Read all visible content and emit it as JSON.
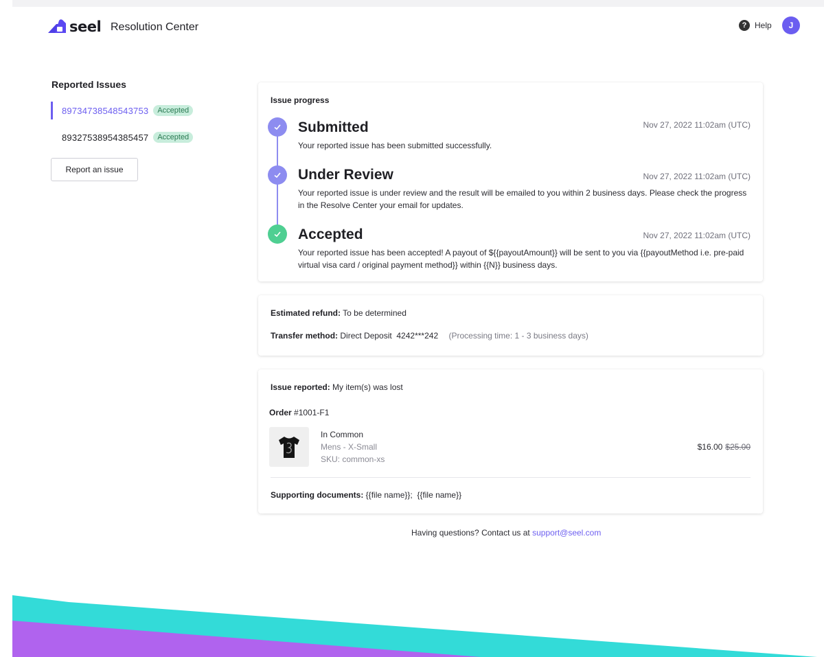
{
  "header": {
    "logo_word": "seel",
    "app_title": "Resolution Center",
    "help_label": "Help",
    "avatar_initial": "J"
  },
  "sidebar": {
    "title": "Reported Issues",
    "issues": [
      {
        "id": "89734738548543753",
        "status": "Accepted",
        "active": true
      },
      {
        "id": "89327538954385457",
        "status": "Accepted",
        "active": false
      }
    ],
    "report_button": "Report an issue"
  },
  "progress": {
    "heading": "Issue progress",
    "steps": [
      {
        "title": "Submitted",
        "time": "Nov 27, 2022  11:02am (UTC)",
        "desc": "Your reported issue has been submitted successfully.",
        "color": "#8d8cf0"
      },
      {
        "title": "Under Review",
        "time": "Nov 27, 2022  11:02am (UTC)",
        "desc": "Your reported issue is under review and the result will be emailed to you within 2 business days. Please check the progress in the Resolve Center your email for updates.",
        "color": "#8d8cf0"
      },
      {
        "title": "Accepted",
        "time": "Nov 27, 2022  11:02am (UTC)",
        "desc": "Your reported issue has been accepted! A payout of ${{payoutAmount}} will be sent to you via {{payoutMethod i.e. pre-paid virtual visa card / original payment method}} within {{N}} business days.",
        "color": "#4fcf92"
      }
    ]
  },
  "refund": {
    "estimated_label": "Estimated refund:",
    "estimated_value": "To be determined",
    "transfer_label": "Transfer method:",
    "transfer_value": "Direct Deposit  4242***242",
    "processing_note": "(Processing time: 1 - 3 business days)"
  },
  "reported": {
    "issue_label": "Issue reported:",
    "issue_value": "My item(s) was lost",
    "order_label": "Order",
    "order_number": "#1001-F1",
    "product": {
      "name": "In Common",
      "variant": "Mens - X-Small",
      "sku": "SKU: common-xs",
      "price": "$16.00",
      "original_price": "$25.00"
    },
    "documents_label": "Supporting documents:",
    "documents_value": "{{file name}};  {{file name}}"
  },
  "footer": {
    "text": "Having questions? Contact us at",
    "email": "support@seel.com"
  },
  "colors": {
    "accent": "#6c5ef0",
    "timeline": "#8d8cf0",
    "success": "#4fcf92",
    "badge_bg": "#c8eddc",
    "wave_teal": "#33dbd8",
    "wave_purple": "#b063ee"
  },
  "icons": {
    "logo": "seel-logo-icon",
    "help": "help-icon",
    "check": "check-icon",
    "product": "tshirt-icon"
  }
}
